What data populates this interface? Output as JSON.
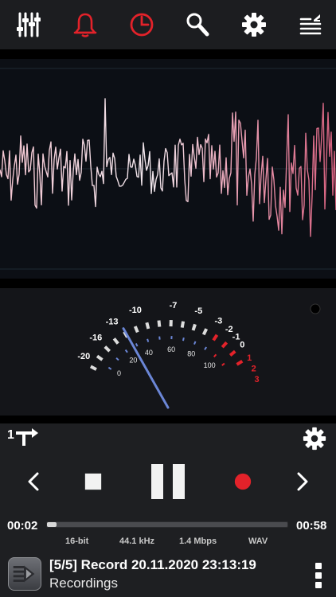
{
  "toolbar": {
    "icons": [
      "mixer-icon",
      "bell-icon",
      "clock-icon",
      "search-icon",
      "gear-icon",
      "playlist-icon"
    ],
    "colors": {
      "white": "#ffffff",
      "alert_red": "#e3222a"
    }
  },
  "vu_meter": {
    "top_scale": [
      "-20",
      "-16",
      "-13",
      "-10",
      "-7",
      "-5",
      "-3",
      "-2",
      "-1",
      "0",
      "1",
      "2",
      "3"
    ],
    "bottom_scale": [
      "0",
      "20",
      "40",
      "60",
      "80",
      "100"
    ],
    "needle_level_db": -9.5,
    "colors": {
      "needle": "#6b86d6",
      "red_zone": "#e3222a"
    }
  },
  "player": {
    "elapsed": "00:02",
    "total": "00:58",
    "progress_fraction": 0.04,
    "format": {
      "bit_depth": "16-bit",
      "sample_rate": "44.1 kHz",
      "bitrate": "1.4 Mbps",
      "container": "WAV"
    },
    "record_color": "#e3222a"
  },
  "track": {
    "title": "[5/5] Record 20.11.2020 23:13:19",
    "folder": "Recordings"
  }
}
